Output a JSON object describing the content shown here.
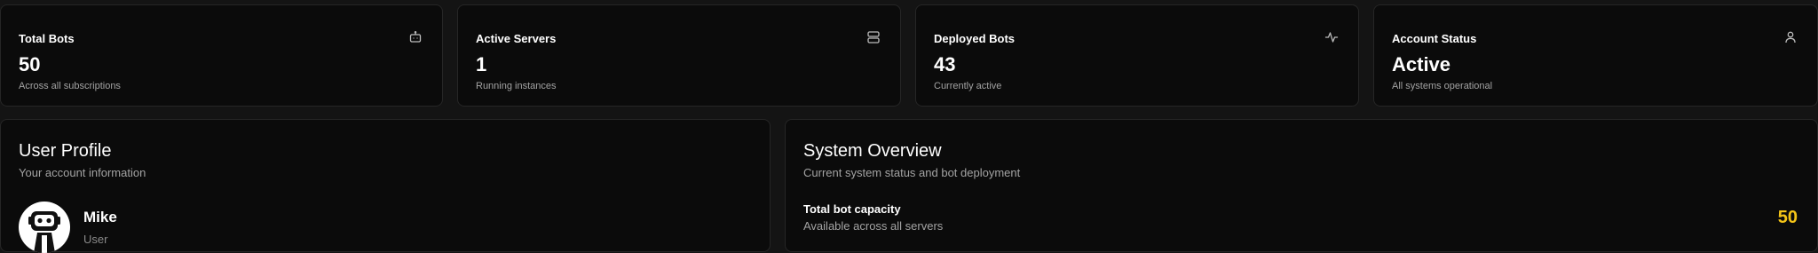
{
  "stats": [
    {
      "title": "Total Bots",
      "value": "50",
      "subtitle": "Across all subscriptions",
      "icon": "bot-icon"
    },
    {
      "title": "Active Servers",
      "value": "1",
      "subtitle": "Running instances",
      "icon": "server-icon"
    },
    {
      "title": "Deployed Bots",
      "value": "43",
      "subtitle": "Currently active",
      "icon": "activity-icon"
    },
    {
      "title": "Account Status",
      "value": "Active",
      "subtitle": "All systems operational",
      "icon": "user-icon"
    }
  ],
  "profile": {
    "title": "User Profile",
    "subtitle": "Your account information",
    "name": "Mike",
    "role": "User"
  },
  "overview": {
    "title": "System Overview",
    "subtitle": "Current system status and bot deployment",
    "capacity_label": "Total bot capacity",
    "capacity_sub": "Available across all servers",
    "capacity_value": "50"
  },
  "colors": {
    "background": "#141414",
    "card": "#0b0b0b",
    "border": "#262626",
    "muted_text": "#a3a3a3",
    "accent_yellow": "#f5c518"
  }
}
